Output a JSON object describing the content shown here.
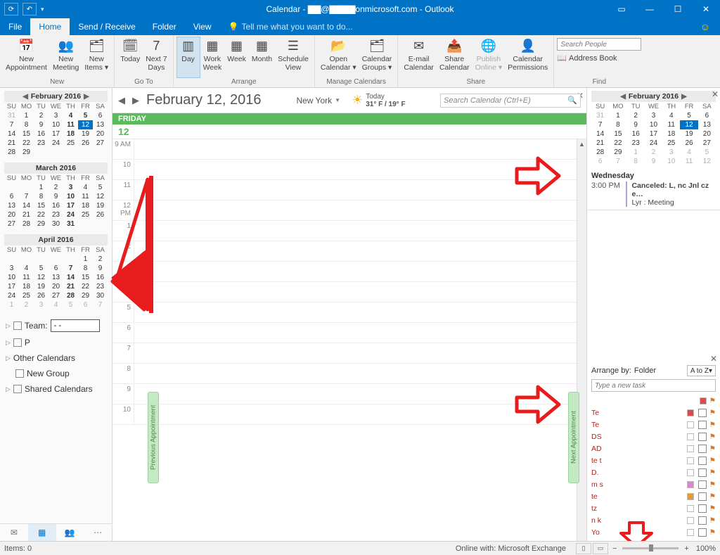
{
  "title": "Calendar - ▇▇@▇▇▇▇onmicrosoft.com - Outlook",
  "tabs": {
    "file": "File",
    "home": "Home",
    "sendreceive": "Send / Receive",
    "folder": "Folder",
    "view": "View",
    "tellme": "Tell me what you want to do..."
  },
  "ribbon": {
    "new": {
      "label": "New",
      "appointment": "New\nAppointment",
      "meeting": "New\nMeeting",
      "items": "New\nItems ▾"
    },
    "goto": {
      "label": "Go To",
      "today": "Today",
      "next7": "Next 7\nDays"
    },
    "arrange": {
      "label": "Arrange",
      "day": "Day",
      "workweek": "Work\nWeek",
      "week": "Week",
      "month": "Month",
      "schedule": "Schedule\nView"
    },
    "managecal": {
      "label": "Manage Calendars",
      "open": "Open\nCalendar ▾",
      "groups": "Calendar\nGroups ▾"
    },
    "share": {
      "label": "Share",
      "email": "E-mail\nCalendar",
      "sharecal": "Share\nCalendar",
      "publish": "Publish\nOnline ▾",
      "perm": "Calendar\nPermissions"
    },
    "find": {
      "label": "Find",
      "search_ph": "Search People",
      "address": "Address Book"
    }
  },
  "left": {
    "months": [
      {
        "title": "February 2016",
        "nav": true,
        "dow": [
          "SU",
          "MO",
          "TU",
          "WE",
          "TH",
          "FR",
          "SA"
        ],
        "weeks": [
          [
            {
              "d": 31,
              "o": 1
            },
            {
              "d": 1
            },
            {
              "d": 2
            },
            {
              "d": 3
            },
            {
              "d": 4,
              "b": 1
            },
            {
              "d": 5,
              "b": 1
            },
            {
              "d": 6
            }
          ],
          [
            {
              "d": 7
            },
            {
              "d": 8
            },
            {
              "d": 9
            },
            {
              "d": 10
            },
            {
              "d": 11,
              "b": 1
            },
            {
              "d": 12,
              "s": 1
            },
            {
              "d": 13
            }
          ],
          [
            {
              "d": 14
            },
            {
              "d": 15
            },
            {
              "d": 16
            },
            {
              "d": 17
            },
            {
              "d": 18,
              "b": 1
            },
            {
              "d": 19
            },
            {
              "d": 20
            }
          ],
          [
            {
              "d": 21
            },
            {
              "d": 22
            },
            {
              "d": 23
            },
            {
              "d": 24
            },
            {
              "d": 25
            },
            {
              "d": 26
            },
            {
              "d": 27
            }
          ],
          [
            {
              "d": 28
            },
            {
              "d": 29
            },
            {
              "d": ""
            },
            {
              "d": ""
            },
            {
              "d": ""
            },
            {
              "d": ""
            },
            {
              "d": ""
            }
          ]
        ]
      },
      {
        "title": "March 2016",
        "dow": [
          "SU",
          "MO",
          "TU",
          "WE",
          "TH",
          "FR",
          "SA"
        ],
        "weeks": [
          [
            {
              "d": ""
            },
            {
              "d": ""
            },
            {
              "d": 1
            },
            {
              "d": 2
            },
            {
              "d": 3,
              "b": 1
            },
            {
              "d": 4
            },
            {
              "d": 5
            }
          ],
          [
            {
              "d": 6
            },
            {
              "d": 7
            },
            {
              "d": 8
            },
            {
              "d": 9
            },
            {
              "d": 10,
              "b": 1
            },
            {
              "d": 11
            },
            {
              "d": 12
            }
          ],
          [
            {
              "d": 13
            },
            {
              "d": 14
            },
            {
              "d": 15
            },
            {
              "d": 16
            },
            {
              "d": 17,
              "b": 1
            },
            {
              "d": 18
            },
            {
              "d": 19
            }
          ],
          [
            {
              "d": 20
            },
            {
              "d": 21
            },
            {
              "d": 22
            },
            {
              "d": 23
            },
            {
              "d": 24,
              "b": 1
            },
            {
              "d": 25
            },
            {
              "d": 26
            }
          ],
          [
            {
              "d": 27
            },
            {
              "d": 28
            },
            {
              "d": 29
            },
            {
              "d": 30
            },
            {
              "d": 31,
              "b": 1
            },
            {
              "d": ""
            },
            {
              "d": ""
            }
          ]
        ]
      },
      {
        "title": "April 2016",
        "dow": [
          "SU",
          "MO",
          "TU",
          "WE",
          "TH",
          "FR",
          "SA"
        ],
        "weeks": [
          [
            {
              "d": ""
            },
            {
              "d": ""
            },
            {
              "d": ""
            },
            {
              "d": ""
            },
            {
              "d": ""
            },
            {
              "d": 1
            },
            {
              "d": 2
            }
          ],
          [
            {
              "d": 3
            },
            {
              "d": 4
            },
            {
              "d": 5
            },
            {
              "d": 6
            },
            {
              "d": 7,
              "b": 1
            },
            {
              "d": 8
            },
            {
              "d": 9
            }
          ],
          [
            {
              "d": 10
            },
            {
              "d": 11
            },
            {
              "d": 12
            },
            {
              "d": 13
            },
            {
              "d": 14,
              "b": 1
            },
            {
              "d": 15
            },
            {
              "d": 16
            }
          ],
          [
            {
              "d": 17
            },
            {
              "d": 18
            },
            {
              "d": 19
            },
            {
              "d": 20
            },
            {
              "d": 21,
              "b": 1
            },
            {
              "d": 22
            },
            {
              "d": 23
            }
          ],
          [
            {
              "d": 24
            },
            {
              "d": 25
            },
            {
              "d": 26
            },
            {
              "d": 27
            },
            {
              "d": 28,
              "b": 1
            },
            {
              "d": 29
            },
            {
              "d": 30
            }
          ],
          [
            {
              "d": 1,
              "o": 1
            },
            {
              "d": 2,
              "o": 1
            },
            {
              "d": 3,
              "o": 1
            },
            {
              "d": 4,
              "o": 1
            },
            {
              "d": 5,
              "o": 1
            },
            {
              "d": 6,
              "o": 1
            },
            {
              "d": 7,
              "o": 1
            }
          ]
        ]
      }
    ],
    "team_label": "Team:",
    "p_label": "P",
    "other_cal": "Other Calendars",
    "new_group": "New Group",
    "shared_cal": "Shared Calendars"
  },
  "main": {
    "date": "February 12, 2016",
    "location": "New York",
    "weather": {
      "label": "Today",
      "temps": "31° F / 19° F"
    },
    "search_ph": "Search Calendar (Ctrl+E)",
    "day_label": "FRIDAY",
    "day_num": "12",
    "hours": [
      "9 AM",
      "10",
      "11",
      "12 PM",
      "1",
      "2",
      "3",
      "4",
      "5",
      "6",
      "7",
      "8",
      "9",
      "10"
    ],
    "prev_appt": "Previous Appointment",
    "next_appt": "Next Appointment"
  },
  "right": {
    "month": {
      "title": "February 2016",
      "dow": [
        "SU",
        "MO",
        "TU",
        "WE",
        "TH",
        "FR",
        "SA"
      ],
      "weeks": [
        [
          {
            "d": 31,
            "o": 1
          },
          {
            "d": 1
          },
          {
            "d": 2
          },
          {
            "d": 3
          },
          {
            "d": 4
          },
          {
            "d": 5
          },
          {
            "d": 6
          }
        ],
        [
          {
            "d": 7
          },
          {
            "d": 8
          },
          {
            "d": 9
          },
          {
            "d": 10
          },
          {
            "d": 11
          },
          {
            "d": 12,
            "s": 1
          },
          {
            "d": 13
          }
        ],
        [
          {
            "d": 14
          },
          {
            "d": 15
          },
          {
            "d": 16
          },
          {
            "d": 17
          },
          {
            "d": 18
          },
          {
            "d": 19
          },
          {
            "d": 20
          }
        ],
        [
          {
            "d": 21
          },
          {
            "d": 22
          },
          {
            "d": 23
          },
          {
            "d": 24
          },
          {
            "d": 25
          },
          {
            "d": 26
          },
          {
            "d": 27
          }
        ],
        [
          {
            "d": 28
          },
          {
            "d": 29
          },
          {
            "d": 1,
            "o": 1
          },
          {
            "d": 2,
            "o": 1
          },
          {
            "d": 3,
            "o": 1
          },
          {
            "d": 4,
            "o": 1
          },
          {
            "d": 5,
            "o": 1
          }
        ],
        [
          {
            "d": 6,
            "o": 1
          },
          {
            "d": 7,
            "o": 1
          },
          {
            "d": 8,
            "o": 1
          },
          {
            "d": 9,
            "o": 1
          },
          {
            "d": 10,
            "o": 1
          },
          {
            "d": 11,
            "o": 1
          },
          {
            "d": 12,
            "o": 1
          }
        ]
      ]
    },
    "agenda": {
      "day": "Wednesday",
      "time": "3:00 PM",
      "title": "Canceled: L, nc  Jnl    cz e…",
      "sub": "Lyr : Meeting"
    },
    "tasks": {
      "arrange": "Arrange by:",
      "folder": "Folder",
      "sort": "A to Z",
      "new_ph": "Type a new task",
      "items": [
        {
          "t": "Te",
          "c": "#d94c4c"
        },
        {
          "t": "Te",
          "c": ""
        },
        {
          "t": "DS",
          "c": ""
        },
        {
          "t": "AD",
          "c": ""
        },
        {
          "t": "te t",
          "c": ""
        },
        {
          "t": "D.",
          "c": ""
        },
        {
          "t": "m s",
          "c": "#d78bcd"
        },
        {
          "t": "te",
          "c": "#e39a3b"
        },
        {
          "t": "tz",
          "c": ""
        },
        {
          "t": "n    k",
          "c": ""
        },
        {
          "t": "Yo",
          "c": ""
        }
      ]
    }
  },
  "status": {
    "items": "Items: 0",
    "online": "Online with: Microsoft Exchange",
    "zoom": "100%"
  }
}
